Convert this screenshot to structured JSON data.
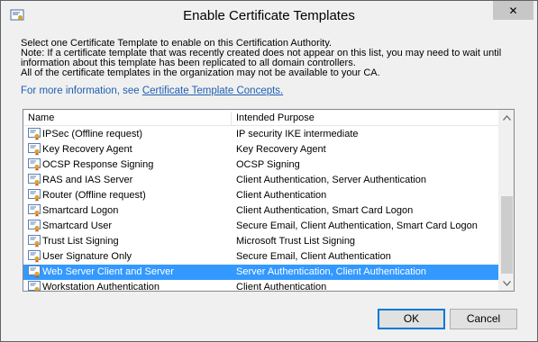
{
  "window": {
    "title": "Enable Certificate Templates",
    "close_label": "✕"
  },
  "description": {
    "lines": [
      "Select one Certificate Template to enable on this Certification Authority.",
      "Note: If a certificate template that was recently created does not appear on this list, you may need to wait until",
      "information about this template has been replicated to all domain controllers.",
      "All of the certificate templates in the organization may not be available to your CA."
    ],
    "more_info_prefix": "For more information, see ",
    "more_info_link": "Certificate Template Concepts."
  },
  "list": {
    "columns": [
      "Name",
      "Intended Purpose"
    ],
    "rows": [
      {
        "name": "IPSec (Offline request)",
        "purpose": "IP security IKE intermediate",
        "selected": false
      },
      {
        "name": "Key Recovery Agent",
        "purpose": "Key Recovery Agent",
        "selected": false
      },
      {
        "name": "OCSP Response Signing",
        "purpose": "OCSP Signing",
        "selected": false
      },
      {
        "name": "RAS and IAS Server",
        "purpose": "Client Authentication, Server Authentication",
        "selected": false
      },
      {
        "name": "Router (Offline request)",
        "purpose": "Client Authentication",
        "selected": false
      },
      {
        "name": "Smartcard Logon",
        "purpose": "Client Authentication, Smart Card Logon",
        "selected": false
      },
      {
        "name": "Smartcard User",
        "purpose": "Secure Email, Client Authentication, Smart Card Logon",
        "selected": false
      },
      {
        "name": "Trust List Signing",
        "purpose": "Microsoft Trust List Signing",
        "selected": false
      },
      {
        "name": "User Signature Only",
        "purpose": "Secure Email, Client Authentication",
        "selected": false
      },
      {
        "name": "Web Server Client and Server",
        "purpose": "Server Authentication, Client Authentication",
        "selected": true
      },
      {
        "name": "Workstation Authentication",
        "purpose": "Client Authentication",
        "selected": false
      }
    ]
  },
  "buttons": {
    "ok": "OK",
    "cancel": "Cancel"
  },
  "colors": {
    "selection": "#3399ff",
    "link": "#1e5fb0"
  }
}
